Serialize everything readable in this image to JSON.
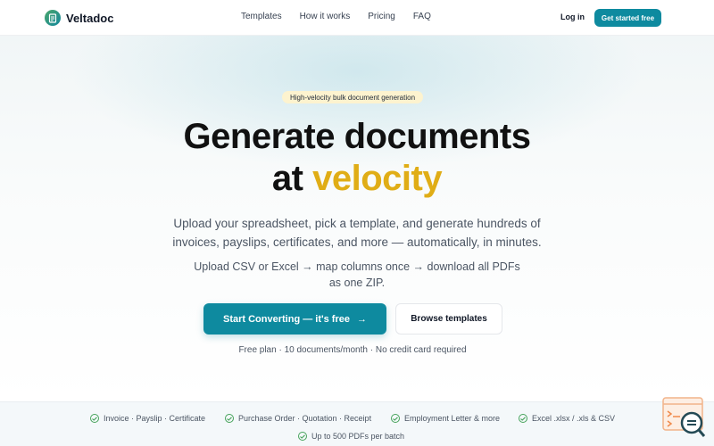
{
  "nav": {
    "brand": "Veltadoc",
    "links": [
      "Templates",
      "How it works",
      "Pricing",
      "FAQ"
    ],
    "login": "Log in",
    "cta": "Get started free"
  },
  "hero": {
    "pill": "High-velocity bulk document generation",
    "headline_line1": "Generate documents",
    "headline_at": "at",
    "headline_accent": "velocity",
    "subtitle": "Upload your spreadsheet, pick a template, and generate hundreds of invoices, payslips, certificates, and more — automatically, in minutes.",
    "subtitle2": "Upload CSV or Excel → map columns once → download all PDFs as one ZIP.",
    "primary_button": "Start Converting — it's free",
    "primary_arrow": "→",
    "secondary_button": "Browse templates",
    "note": "Free plan · 10 documents/month · No credit card required"
  },
  "features": [
    "Invoice · Payslip · Certificate",
    "Purchase Order · Quotation · Receipt",
    "Employment Letter & more",
    "Excel .xlsx / .xls & CSV",
    "Up to 500 PDFs per batch"
  ],
  "icons": {
    "logo": "document-icon",
    "check": "check-circle-icon",
    "widget": "search-chat-icon"
  },
  "colors": {
    "primary": "#0e8a9f",
    "accent": "#e0ad16",
    "pill_bg": "#fdf3cf",
    "check": "#46a35b"
  }
}
